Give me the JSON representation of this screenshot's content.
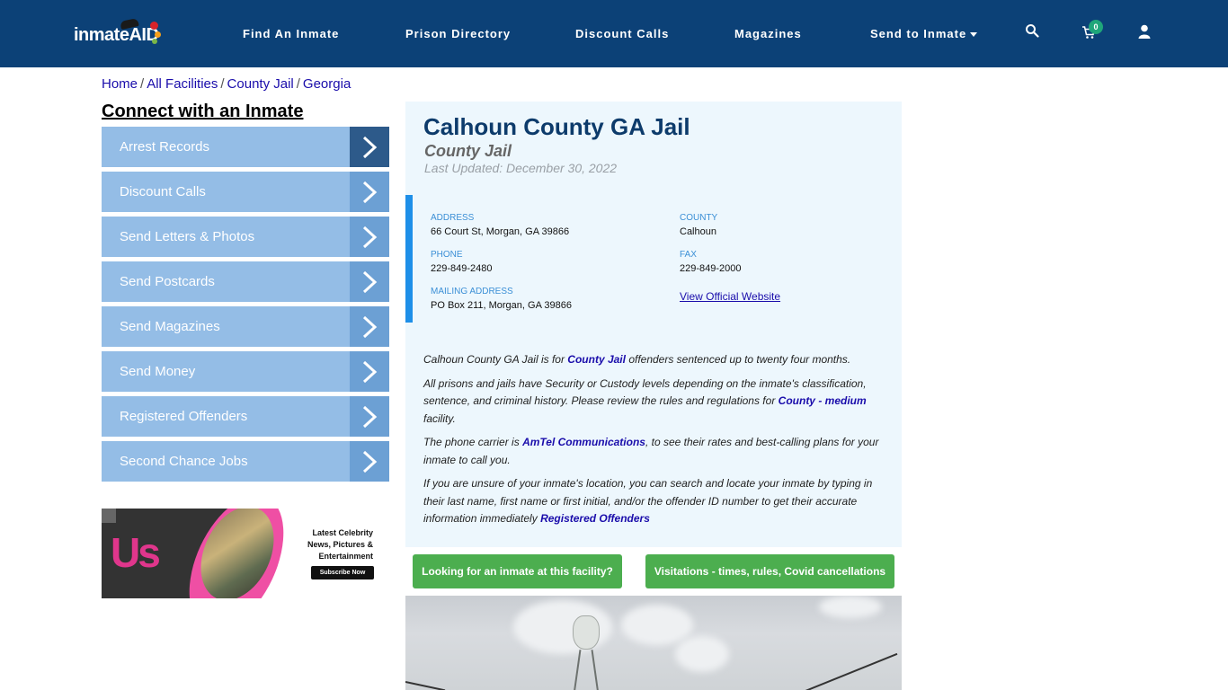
{
  "navbar": {
    "logo_text": "inmateAID",
    "links": [
      {
        "label": "Find An Inmate"
      },
      {
        "label": "Prison Directory"
      },
      {
        "label": "Discount Calls"
      },
      {
        "label": "Magazines"
      },
      {
        "label": "Send to Inmate",
        "has_dropdown": true
      }
    ],
    "icons": [
      "search-icon",
      "cart-icon",
      "user-icon"
    ],
    "cart_count": "0"
  },
  "breadcrumb": [
    "Home",
    "All Facilities",
    "County Jail",
    "Georgia"
  ],
  "sidebar": {
    "title": "Connect with an Inmate",
    "items": [
      {
        "label": "Arrest Records"
      },
      {
        "label": "Discount Calls"
      },
      {
        "label": "Send Letters & Photos"
      },
      {
        "label": "Send Postcards"
      },
      {
        "label": "Send Magazines"
      },
      {
        "label": "Send Money"
      },
      {
        "label": "Registered Offenders"
      },
      {
        "label": "Second Chance Jobs"
      }
    ],
    "ad": {
      "brand": "Us",
      "text_lines": [
        "Latest Celebrity",
        "News, Pictures &",
        "Entertainment"
      ],
      "button": "Subscribe Now"
    }
  },
  "facility": {
    "name": "Calhoun County GA Jail",
    "type": "County Jail",
    "last_updated": "Last Updated: December 30, 2022",
    "address_label": "ADDRESS",
    "address": "66 Court St, Morgan, GA 39866",
    "county_label": "COUNTY",
    "county": "Calhoun",
    "phone_label": "PHONE",
    "phone": "229-849-2480",
    "fax_label": "FAX",
    "fax": "229-849-2000",
    "mailing_label": "MAILING ADDRESS",
    "mailing": "PO Box 211, Morgan, GA 39866",
    "website_link": "View Official Website"
  },
  "description": {
    "p1_a": "Calhoun County GA Jail is for ",
    "p1_link": "County Jail",
    "p1_b": " offenders sentenced up to twenty four months.",
    "p2_a": "All prisons and jails have Security or Custody levels depending on the inmate's classification, sentence, and criminal history. Please review the rules and regulations for ",
    "p2_link": "County - medium",
    "p2_b": " facility.",
    "p3_a": "The phone carrier is ",
    "p3_link": "AmTel Communications",
    "p3_b": ", to see their rates and best-calling plans for your inmate to call you.",
    "p4_a": "If you are unsure of your inmate's location, you can search and locate your inmate by typing in their last name, first name or first initial, and/or the offender ID number to get their accurate information immediately ",
    "p4_link": "Registered Offenders"
  },
  "buttons": {
    "find_inmate": "Looking for an inmate at this facility?",
    "visitations": "Visitations - times, rules, Covid cancellations"
  },
  "colors": {
    "navbar": "#0c4177",
    "sidebar_item": "#94bde6",
    "sidebar_arrow": "#6ca0d4",
    "sidebar_arrow_active": "#2d5a8a",
    "card_bg": "#edf7fd",
    "accent_bar": "#1e8fe8",
    "button_green": "#4cae4f",
    "title": "#0d3b6b"
  }
}
